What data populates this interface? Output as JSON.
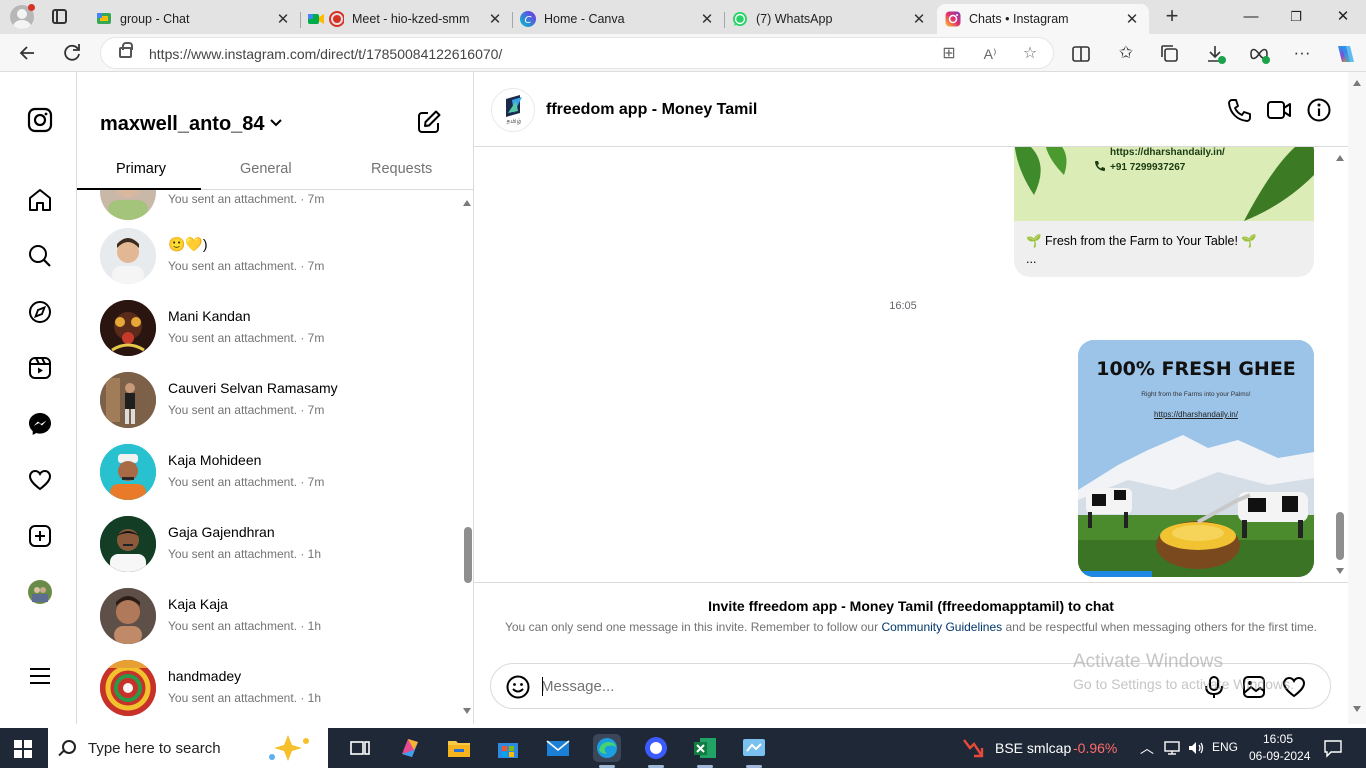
{
  "browser": {
    "tabs": [
      {
        "title": "group - Chat",
        "favicon": "google-chat",
        "active": false
      },
      {
        "title": "Meet - hio-kzed-smm",
        "favicon": "google-meet-recording",
        "active": false
      },
      {
        "title": "Home - Canva",
        "favicon": "canva",
        "active": false
      },
      {
        "title": "(7) WhatsApp",
        "favicon": "whatsapp",
        "active": false
      },
      {
        "title": "Chats • Instagram",
        "favicon": "instagram",
        "active": true
      }
    ],
    "new_tab": "+",
    "window": {
      "minimize": "—",
      "restore": "❐",
      "close": "✕"
    },
    "url": "https://www.instagram.com/direct/t/17850084122616070/"
  },
  "sidebar": {
    "items": [
      "instagram-logo",
      "home",
      "search",
      "explore",
      "reels",
      "messenger",
      "notifications",
      "create",
      "profile",
      "more-menu"
    ]
  },
  "conversations": {
    "username": "maxwell_anto_84",
    "tabs": [
      "Primary",
      "General",
      "Requests"
    ],
    "active_tab": "Primary",
    "partial_top_sub": "You sent an attachment. · 7m",
    "items": [
      {
        "name": "🙂💛)",
        "sub": "You sent an attachment. · 7m"
      },
      {
        "name": "Mani Kandan",
        "sub": "You sent an attachment. · 7m"
      },
      {
        "name": "Cauveri Selvan Ramasamy",
        "sub": "You sent an attachment. · 7m"
      },
      {
        "name": "Kaja Mohideen",
        "sub": "You sent an attachment. · 7m"
      },
      {
        "name": "Gaja Gajendhran",
        "sub": "You sent an attachment. · 1h"
      },
      {
        "name": "Kaja Kaja",
        "sub": "You sent an attachment. · 1h"
      },
      {
        "name": "handmadey",
        "sub": "You sent an attachment. · 1h"
      }
    ]
  },
  "chat": {
    "name": "ffreedom app - Money Tamil",
    "avatar_caption": "தமிழ்",
    "messages": {
      "card1": {
        "url": "https://dharshandaily.in/",
        "phone": "+91 7299937267",
        "text": "🌱 Fresh from the Farm to Your Table! 🌱",
        "more": "..."
      },
      "timestamp": "16:05",
      "card2": {
        "title": "100% FRESH GHEE",
        "subtitle": "Right from the Farms into your Palms!",
        "url": "https://dharshandaily.in/"
      }
    },
    "invite": {
      "title": "Invite ffreedom app - Money Tamil (ffreedomapptamil) to chat",
      "note_before": "You can only send one message in this invite. Remember to follow our",
      "note_link": "Community Guidelines",
      "note_after": "and be respectful when messaging others for the first time."
    },
    "composer": {
      "placeholder": "Message..."
    }
  },
  "watermark": {
    "line1": "Activate Windows",
    "line2": "Go to Settings to activate Windows."
  },
  "taskbar": {
    "search_placeholder": "Type here to search",
    "stock": {
      "name": "BSE smlcap",
      "change": "-0.96%",
      "change_color": "#ff6b6b"
    },
    "language": "ENG",
    "time": "16:05",
    "date": "06-09-2024"
  }
}
